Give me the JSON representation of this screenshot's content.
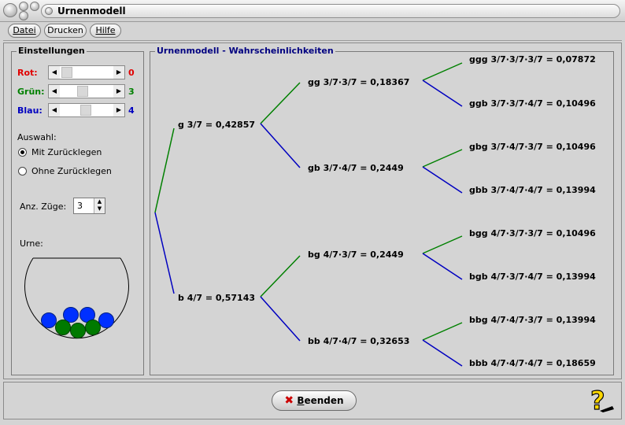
{
  "window": {
    "title": "Urnenmodell"
  },
  "menu": {
    "items": [
      "Datei",
      "Drucken",
      "Hilfe"
    ]
  },
  "settings": {
    "title": "Einstellungen",
    "colors": [
      {
        "label": "Rot:",
        "value": "0",
        "color": "#e00000",
        "fraction": 0.0
      },
      {
        "label": "Grün:",
        "value": "3",
        "color": "#008000",
        "fraction": 0.3
      },
      {
        "label": "Blau:",
        "value": "4",
        "color": "#0000c0",
        "fraction": 0.4
      }
    ],
    "selection_label": "Auswahl:",
    "options": [
      {
        "label": "Mit Zurücklegen",
        "checked": true
      },
      {
        "label": "Ohne Zurücklegen",
        "checked": false
      }
    ],
    "draws_label": "Anz. Züge:",
    "draws_value": "3",
    "urn_label": "Urne:"
  },
  "tree": {
    "title": "Urnenmodell - Wahrscheinlichkeiten",
    "level1": [
      "g 3/7 = 0,42857",
      "b 4/7 = 0,57143"
    ],
    "level2": [
      "gg 3/7·3/7 = 0,18367",
      "gb 3/7·4/7 = 0,2449",
      "bg 4/7·3/7 = 0,2449",
      "bb 4/7·4/7 = 0,32653"
    ],
    "level3": [
      "ggg 3/7·3/7·3/7 = 0,07872",
      "ggb 3/7·3/7·4/7 = 0,10496",
      "gbg 3/7·4/7·3/7 = 0,10496",
      "gbb 3/7·4/7·4/7 = 0,13994",
      "bgg 4/7·3/7·3/7 = 0,10496",
      "bgb 4/7·3/7·4/7 = 0,13994",
      "bbg 4/7·4/7·3/7 = 0,13994",
      "bbb 4/7·4/7·4/7 = 0,18659"
    ],
    "green": "#008000",
    "blue": "#0000c0"
  },
  "footer": {
    "quit_label": "eenden",
    "quit_underlined": "B"
  }
}
